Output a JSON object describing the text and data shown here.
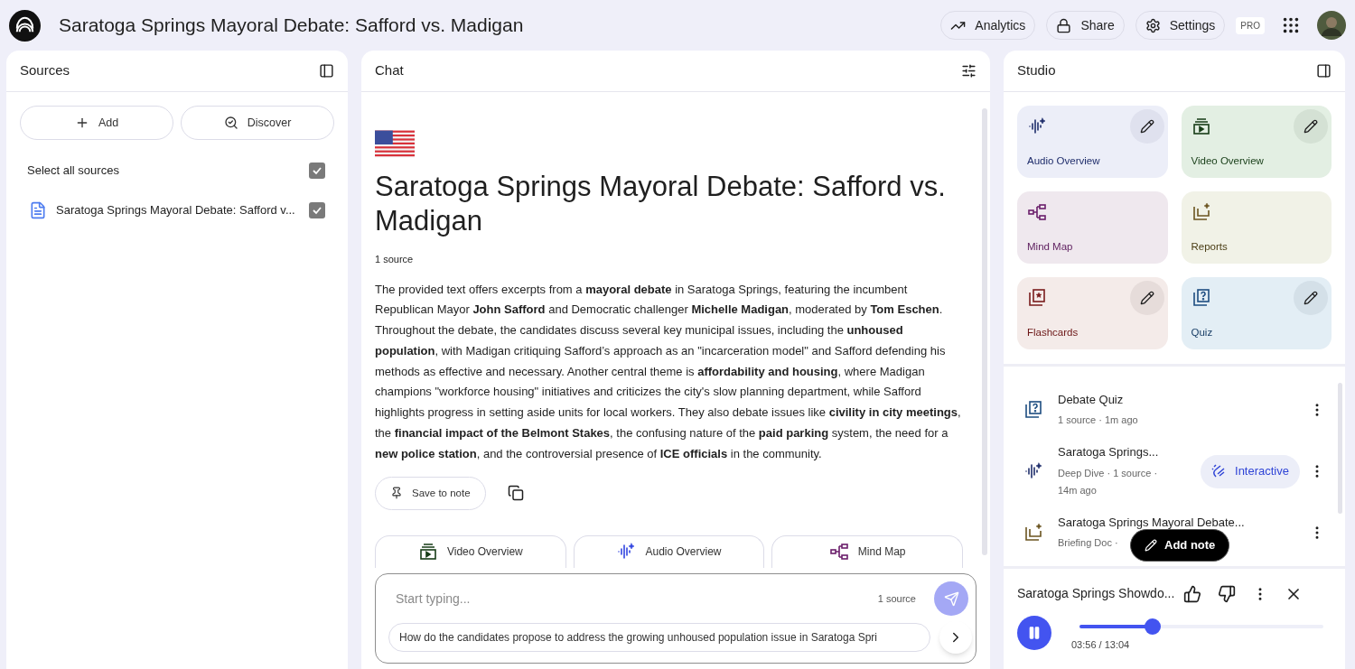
{
  "header": {
    "title": "Saratoga Springs Mayoral Debate: Safford vs. Madigan",
    "actions": [
      {
        "kind": "analytics",
        "label": "Analytics"
      },
      {
        "kind": "share",
        "label": "Share"
      },
      {
        "kind": "settings",
        "label": "Settings"
      }
    ],
    "badge": "PRO"
  },
  "sources": {
    "title": "Sources",
    "buttons": [
      {
        "kind": "add",
        "label": "Add"
      },
      {
        "kind": "discover",
        "label": "Discover"
      }
    ],
    "select_all": {
      "label": "Select all sources",
      "checked": true
    },
    "items": [
      {
        "title": "Saratoga Springs Mayoral Debate: Safford v...",
        "checked": true
      }
    ]
  },
  "chat": {
    "title": "Chat",
    "heading": "Saratoga Springs Mayoral Debate: Safford vs. Madigan",
    "source_count": "1 source",
    "summary": "The provided text offers excerpts from a **mayoral debate** in Saratoga Springs, featuring the incumbent Republican Mayor **John Safford** and Democratic challenger **Michelle Madigan**, moderated by **Tom Eschen**. Throughout the debate, the candidates discuss several key municipal issues, including the **unhoused population**, with Madigan critiquing Safford’s approach as an \"incarceration model\" and Safford defending his methods as effective and necessary. Another central theme is **affordability and housing**, where Madigan champions \"workforce housing\" initiatives and criticizes the city's slow planning department, while Safford highlights progress in setting aside units for local workers. They also debate issues like **civility in city meetings**, the **financial impact of the Belmont Stakes**, the confusing nature of the **paid parking** system, the need for a **new police station**, and the controversial presence of **ICE officials** in the community.",
    "save_button": "Save to note",
    "chips": [
      {
        "kind": "video",
        "label": "Video Overview"
      },
      {
        "kind": "audio",
        "label": "Audio Overview"
      },
      {
        "kind": "mindmap",
        "label": "Mind Map"
      }
    ],
    "input": {
      "placeholder": "Start typing...",
      "source_count": "1 source"
    },
    "suggestion": "How do the candidates propose to address the growing unhoused population issue in Saratoga Spri"
  },
  "studio": {
    "title": "Studio",
    "tiles": [
      {
        "kind": "audio",
        "label": "Audio Overview",
        "editable": true
      },
      {
        "kind": "video",
        "label": "Video Overview",
        "editable": true
      },
      {
        "kind": "mindmap",
        "label": "Mind Map",
        "editable": false
      },
      {
        "kind": "reports",
        "label": "Reports",
        "editable": false
      },
      {
        "kind": "flashcards",
        "label": "Flashcards",
        "editable": true
      },
      {
        "kind": "quiz",
        "label": "Quiz",
        "editable": true
      }
    ],
    "notes": [
      {
        "kind": "quiz",
        "title": "Debate Quiz",
        "meta": "1 source · 1m ago"
      },
      {
        "kind": "audio",
        "title": "Saratoga Springs...",
        "meta": "Deep Dive · 1 source · 14m ago",
        "action": "Interactive"
      },
      {
        "kind": "reports",
        "title": "Saratoga Springs Mayoral Debate...",
        "meta": "Briefing Doc ·"
      }
    ],
    "add_note": "Add note",
    "player": {
      "title": "Saratoga Springs Showdo...",
      "playing": true,
      "level": 0.3,
      "time": "03:56 / 13:04"
    }
  }
}
